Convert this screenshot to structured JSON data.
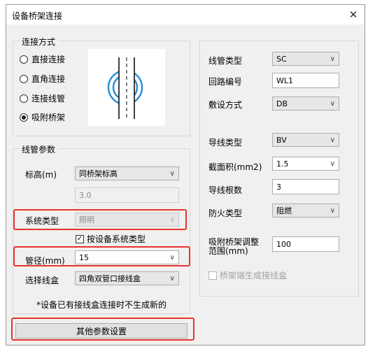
{
  "title": "设备桥架连接",
  "connect": {
    "legend": "连接方式",
    "options": [
      "直接连接",
      "直角连接",
      "连接线管",
      "吸附桥架"
    ],
    "selected_index": 3
  },
  "pipe": {
    "legend": "线管参数",
    "elevation_label": "标高(m)",
    "elevation_value": "同桥架标高",
    "elevation_input": "3.0",
    "system_label": "系统类型",
    "system_value": "照明",
    "by_device_label": "按设备系统类型",
    "by_device_checked": true,
    "diameter_label": "管径(mm)",
    "diameter_value": "15",
    "box_label": "选择线盒",
    "box_value": "四角双管口接线盒",
    "note": "*设备已有接线盒连接时不生成新的"
  },
  "other_button": "其他参数设置",
  "right": {
    "conduit_type_label": "线管类型",
    "conduit_type_value": "SC",
    "circuit_label": "回路编号",
    "circuit_value": "WL1",
    "laying_label": "敷设方式",
    "laying_value": "DB",
    "wire_type_label": "导线类型",
    "wire_type_value": "BV",
    "section_label": "截面积(mm2)",
    "section_value": "1.5",
    "wire_count_label": "导线根数",
    "wire_count_value": "3",
    "fire_label": "防火类型",
    "fire_value": "阻燃",
    "range_label_1": "吸附桥架调整",
    "range_label_2": "范围(mm)",
    "range_value": "100",
    "gen_box_label": "桥架端生成接线盒",
    "gen_box_checked": false
  },
  "colors": {
    "highlight": "#e8322e",
    "preview_circle": "#2b8fd8"
  },
  "icons": {
    "close": "close-icon",
    "dropdown": "chevron-down-icon"
  }
}
